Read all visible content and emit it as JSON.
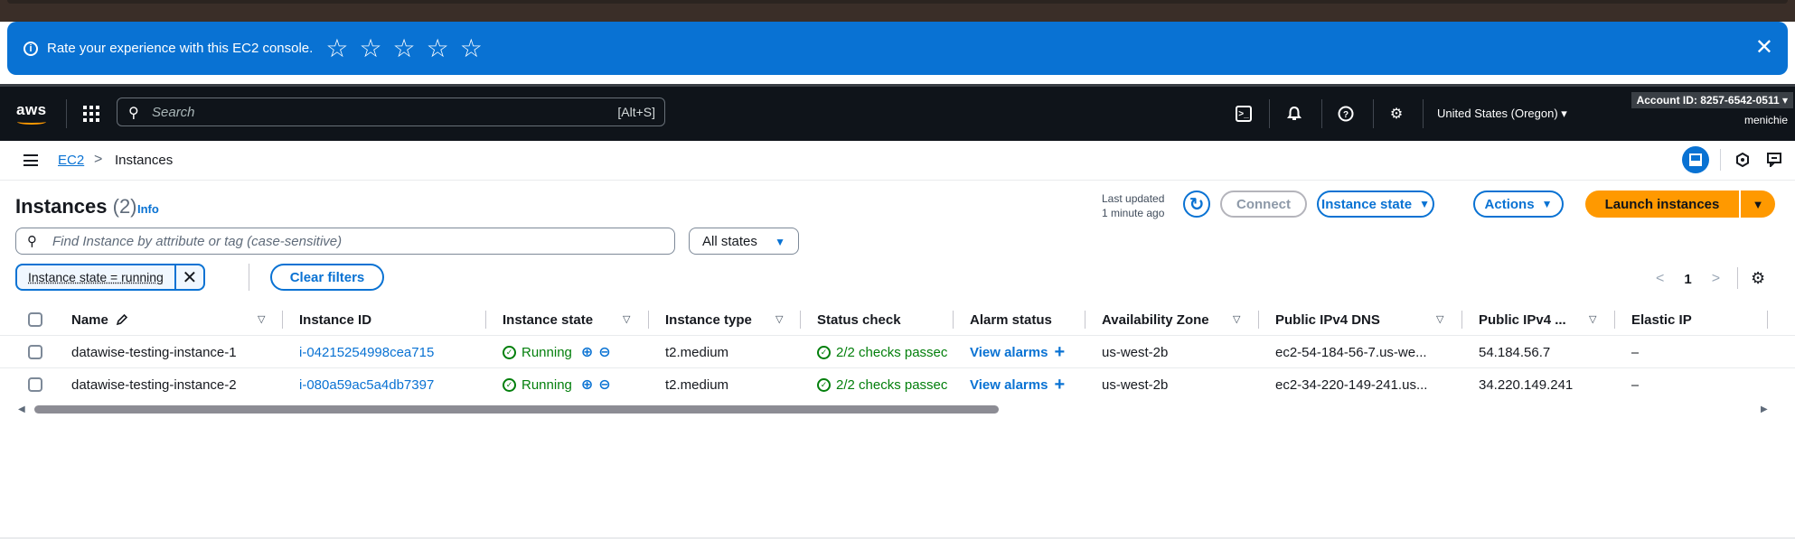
{
  "banner": {
    "message": "Rate your experience with this EC2 console.",
    "star_glyph": "☆",
    "star_count": 5,
    "close_glyph": "✕"
  },
  "nav": {
    "search_placeholder": "Search",
    "search_shortcut": "[Alt+S]",
    "region": "United States (Oregon) ▾",
    "account": "Account ID: 8257-6542-0511 ▾",
    "username": "menichie"
  },
  "breadcrumb": {
    "root": "EC2",
    "separator": ">",
    "current": "Instances"
  },
  "page": {
    "title": "Instances",
    "count": "(2)",
    "info": "Info",
    "last_updated_label": "Last updated",
    "last_updated_value": "1 minute ago",
    "buttons": {
      "connect": "Connect",
      "instance_state": "Instance state",
      "actions": "Actions",
      "launch": "Launch instances"
    },
    "filter_placeholder": "Find Instance by attribute or tag (case-sensitive)",
    "states_select": "All states",
    "token": "Instance state = running",
    "clear_filters": "Clear filters",
    "pagination": {
      "prev": "<",
      "page": "1",
      "next": ">"
    }
  },
  "table": {
    "columns": [
      "Name",
      "Instance ID",
      "Instance state",
      "Instance type",
      "Status check",
      "Alarm status",
      "Availability Zone",
      "Public IPv4 DNS",
      "Public IPv4 ...",
      "Elastic IP"
    ],
    "rows": [
      {
        "name": "datawise-testing-instance-1",
        "instance_id": "i-04215254998cea715",
        "state": "Running",
        "type": "t2.medium",
        "status_check": "2/2 checks passec",
        "alarm": "View alarms",
        "az": "us-west-2b",
        "dns": "ec2-54-184-56-7.us-we...",
        "ipv4": "54.184.56.7",
        "elastic_ip": "–"
      },
      {
        "name": "datawise-testing-instance-2",
        "instance_id": "i-080a59ac5a4db7397",
        "state": "Running",
        "type": "t2.medium",
        "status_check": "2/2 checks passec",
        "alarm": "View alarms",
        "az": "us-west-2b",
        "dns": "ec2-34-220-149-241.us...",
        "ipv4": "34.220.149.241",
        "elastic_ip": "–"
      }
    ]
  },
  "colors": {
    "banner_bg": "#0972d3",
    "navbar_bg": "#0f141a",
    "primary_button": "#ff9900",
    "link": "#0972d3",
    "success": "#037f0c"
  }
}
